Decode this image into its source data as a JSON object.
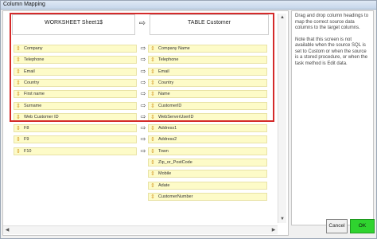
{
  "window": {
    "title": "Column Mapping"
  },
  "headers": {
    "left": "WORKSHEET Sheet1$",
    "right": "TABLE Customer"
  },
  "icons": {
    "field": "field-drag-icon",
    "map": "arrow-right-icon"
  },
  "mappings": [
    {
      "source": "Company",
      "target": "Company Name"
    },
    {
      "source": "Telephone",
      "target": "Telephone"
    },
    {
      "source": "Email",
      "target": "Email"
    },
    {
      "source": "Country",
      "target": "Country"
    },
    {
      "source": "First name",
      "target": "Name"
    },
    {
      "source": "Surname",
      "target": "CustomerID"
    },
    {
      "source": "Web Customer ID",
      "target": "WebServerUserID"
    },
    {
      "source": "F8",
      "target": "Address1"
    },
    {
      "source": "F9",
      "target": "Address2"
    },
    {
      "source": "F10",
      "target": "Town"
    }
  ],
  "unmapped_targets": [
    "Zip_or_PostCode",
    "Mobile",
    "Adate",
    "CustomerNumber"
  ],
  "help": {
    "p1": "Drag and drop column headings to map the correct source data columns to the target columns.",
    "p2": "Note that this screen is not available when the source SQL is set to Custom or when the source is a stored procedure, or when the task method is Edit data."
  },
  "buttons": {
    "cancel": "Cancel",
    "ok": "OK"
  }
}
